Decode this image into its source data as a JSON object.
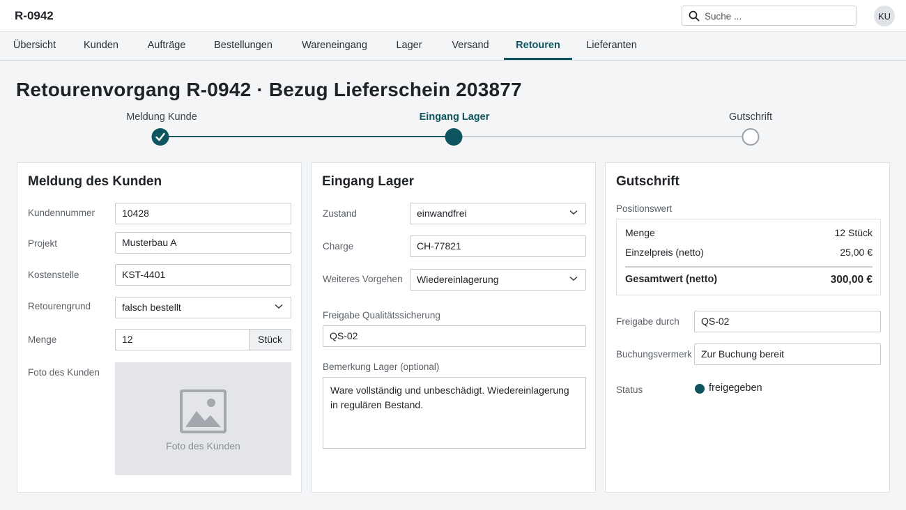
{
  "header": {
    "app_title": "R-0942",
    "search_placeholder": "Suche ...",
    "avatar_initials": "KU"
  },
  "nav": {
    "tabs": [
      {
        "label": "Übersicht"
      },
      {
        "label": "Kunden"
      },
      {
        "label": "Aufträge"
      },
      {
        "label": "Bestellungen"
      },
      {
        "label": "Wareneingang"
      },
      {
        "label": "Lager"
      },
      {
        "label": "Versand"
      },
      {
        "label": "Retouren",
        "active": true
      },
      {
        "label": "Lieferanten"
      }
    ]
  },
  "page": {
    "title": "Retourenvorgang R-0942 · Bezug Lieferschein 203877"
  },
  "stepper": {
    "steps": [
      {
        "label": "Meldung Kunde",
        "state": "done"
      },
      {
        "label": "Eingang Lager",
        "state": "current"
      },
      {
        "label": "Gutschrift",
        "state": "todo"
      }
    ]
  },
  "customer": {
    "title": "Meldung des Kunden",
    "fields": {
      "kundennummer": {
        "label": "Kundennummer",
        "value": "10428"
      },
      "projekt": {
        "label": "Projekt",
        "value": "Musterbau A"
      },
      "kostenstelle": {
        "label": "Kostenstelle",
        "value": "KST-4401"
      },
      "retourengrund": {
        "label": "Retourengrund",
        "value": "falsch bestellt"
      },
      "menge": {
        "label": "Menge",
        "value": "12",
        "unit": "Stück"
      }
    },
    "photo": {
      "label": "Foto des Kunden",
      "caption": "Foto des Kunden"
    }
  },
  "warehouse": {
    "title": "Eingang Lager",
    "zustand": {
      "label": "Zustand",
      "value": "einwandfrei"
    },
    "charge": {
      "label": "Charge",
      "value": "CH-77821"
    },
    "vorgehen": {
      "label": "Weiteres Vorgehen",
      "value": "Wiedereinlagerung"
    },
    "freigabe_qs": {
      "label": "Freigabe Qualitätssicherung",
      "value": "QS-02"
    },
    "bemerkung": {
      "label": "Bemerkung Lager (optional)",
      "value": "Ware vollständig und unbeschädigt. Wiedereinlagerung\nin regulären Bestand."
    }
  },
  "credit": {
    "title": "Gutschrift",
    "positionswert_label": "Positionswert",
    "summary": {
      "menge": {
        "label": "Menge",
        "value": "12 Stück"
      },
      "einzelpreis": {
        "label": "Einzelpreis (netto)",
        "value": "25,00 €"
      },
      "gesamt": {
        "label": "Gesamtwert (netto)",
        "value": "300,00 €"
      }
    },
    "freigabe": {
      "label": "Freigabe durch",
      "value": "QS-02"
    },
    "buchungsvermerk": {
      "label": "Buchungsvermerk",
      "value": "Zur Buchung bereit"
    },
    "status": {
      "label": "Status",
      "value": "freigegeben"
    }
  },
  "colors": {
    "accent": "#0e5560",
    "border": "#c5c9ce",
    "background": "#f4f5f6"
  }
}
